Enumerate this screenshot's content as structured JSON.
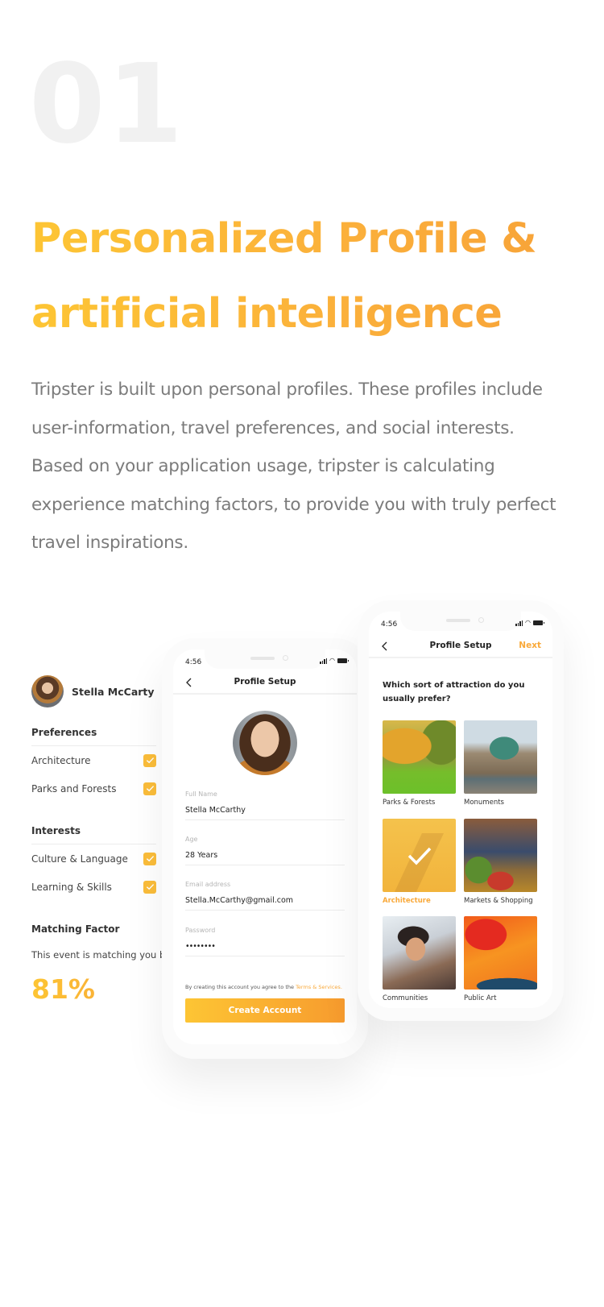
{
  "section_number": "01",
  "headline": {
    "line1": "Personalized Profile &",
    "line2": "artificial intelligence"
  },
  "description": "Tripster is built upon personal profiles. These profiles include user-information, travel preferences, and social interests. Based on your application usage, tripster is calculating experience matching factors, to provide you with truly perfect travel inspirations.",
  "colors": {
    "accent_start": "#fdc534",
    "accent_end": "#f7a138",
    "checkbox": "#fbbd3a",
    "big_number": "#f1f1f1",
    "body_text": "#7b7b7b"
  },
  "profile_card": {
    "user_name": "Stella McCarty",
    "avatar_icon": "user-avatar",
    "preferences": {
      "title": "Preferences",
      "items": [
        {
          "label": "Architecture",
          "checked": true
        },
        {
          "label": "Parks and Forests",
          "checked": true
        }
      ]
    },
    "interests": {
      "title": "Interests",
      "items": [
        {
          "label": "Culture & Language",
          "checked": true
        },
        {
          "label": "Learning & Skills",
          "checked": true
        }
      ]
    },
    "matching": {
      "title": "Matching Factor",
      "text": "This event is matching you by",
      "value": "81%"
    }
  },
  "phone_signup": {
    "status_time": "4:56",
    "title": "Profile Setup",
    "back_icon": "chevron-left-icon",
    "fields": [
      {
        "label": "Full Name",
        "value": "Stella McCarthy"
      },
      {
        "label": "Age",
        "value": "28 Years"
      },
      {
        "label": "Email address",
        "value": "Stella.McCarthy@gmail.com"
      },
      {
        "label": "Password",
        "value": "••••••••"
      }
    ],
    "terms_text": "By creating this account you agree to the ",
    "terms_link": "Terms & Services.",
    "create_button": "Create Account"
  },
  "phone_attractions": {
    "status_time": "4:56",
    "title": "Profile Setup",
    "next_label": "Next",
    "question": "Which sort of attraction do you usually prefer?",
    "tiles": [
      {
        "label": "Parks & Forests",
        "selected": false
      },
      {
        "label": "Monuments",
        "selected": false
      },
      {
        "label": "Architecture",
        "selected": true
      },
      {
        "label": "Markets & Shopping",
        "selected": false
      },
      {
        "label": "Communities",
        "selected": false
      },
      {
        "label": "Public Art",
        "selected": false
      }
    ]
  }
}
